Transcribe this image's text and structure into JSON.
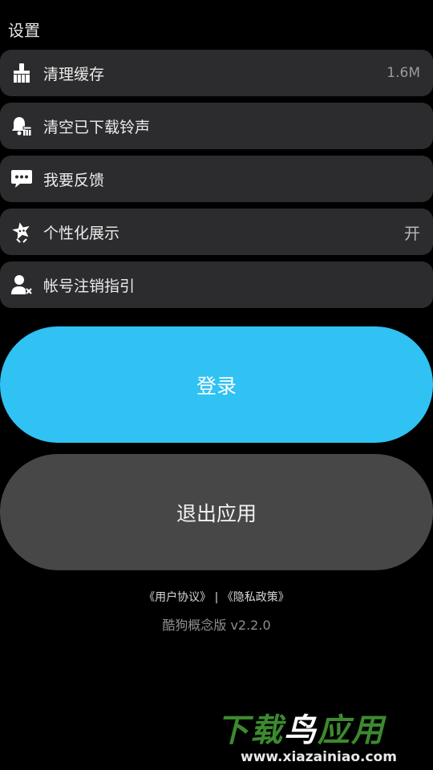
{
  "header": {
    "title": "设置"
  },
  "settings": {
    "items": [
      {
        "label": "清理缓存",
        "value": "1.6M",
        "icon": "broom-icon"
      },
      {
        "label": "清空已下载铃声",
        "value": "",
        "icon": "bell-clear-icon"
      },
      {
        "label": "我要反馈",
        "value": "",
        "icon": "chat-bubble-icon"
      },
      {
        "label": "个性化展示",
        "value": "开",
        "icon": "star-badge-icon"
      },
      {
        "label": "帐号注销指引",
        "value": "",
        "icon": "user-remove-icon"
      }
    ]
  },
  "buttons": {
    "login_label": "登录",
    "exit_label": "退出应用"
  },
  "footer": {
    "user_agreement": "《用户协议》",
    "separator": "|",
    "privacy_policy": "《隐私政策》",
    "version": "酷狗概念版 v2.2.0"
  },
  "watermark": {
    "title_green": "下载",
    "title_white": "鸟",
    "title_green2": "应用",
    "url": "www.xiazainiao.com"
  },
  "colors": {
    "background": "#000000",
    "row_bg": "#2c2c2e",
    "login_bg": "#2fc2f3",
    "exit_bg": "#474747"
  }
}
